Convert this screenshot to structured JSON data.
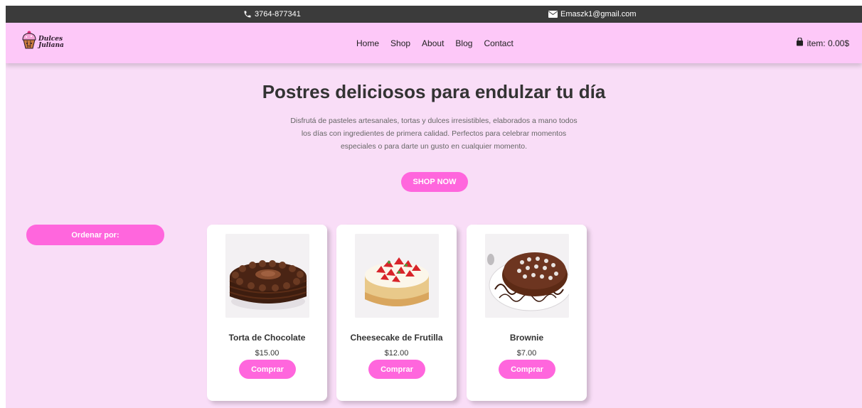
{
  "topbar": {
    "phone": "3764-877341",
    "email": "Emaszk1@gmail.com"
  },
  "header": {
    "logo_line1": "Dulces",
    "logo_line2": "Juliana",
    "nav": [
      "Home",
      "Shop",
      "About",
      "Blog",
      "Contact"
    ],
    "cart_label": "item: 0.00$"
  },
  "hero": {
    "title": "Postres deliciosos para endulzar tu día",
    "description": "Disfrutá de pasteles artesanales, tortas y dulces irresistibles, elaborados a mano todos los días con ingredientes de primera calidad. Perfectos para celebrar momentos especiales o para darte un gusto en cualquier momento.",
    "cta": "SHOP NOW"
  },
  "sort": {
    "label": "Ordenar por:"
  },
  "products": [
    {
      "name": "Torta de Chocolate",
      "price": "$15.00",
      "button": "Comprar",
      "image": "chocolate-cake"
    },
    {
      "name": "Cheesecake de Frutilla",
      "price": "$12.00",
      "button": "Comprar",
      "image": "strawberry-cheesecake"
    },
    {
      "name": "Brownie",
      "price": "$7.00",
      "button": "Comprar",
      "image": "brownie"
    }
  ],
  "colors": {
    "accent": "#ff66dd",
    "header_bg": "#fdc8f8",
    "page_bg": "#f9ddf7",
    "topbar_bg": "#3b3b3b"
  }
}
